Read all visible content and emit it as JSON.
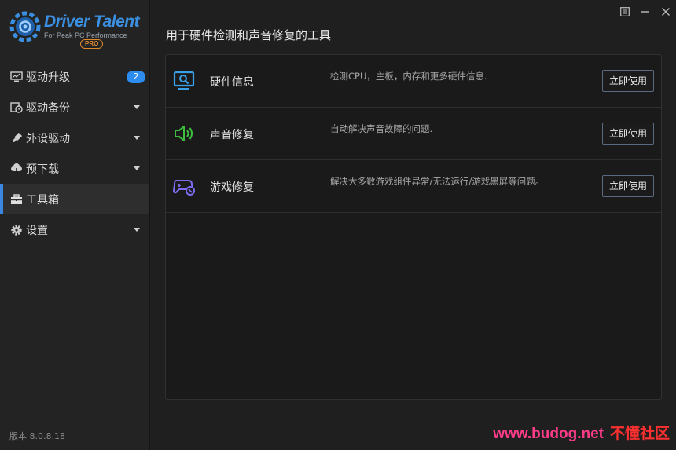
{
  "app": {
    "logo_text": "Driver Talent",
    "logo_sub": "For Peak PC Performance",
    "logo_pro": "PRO",
    "version": "版本 8.0.8.18"
  },
  "sidebar": {
    "items": [
      {
        "label": "驱动升级",
        "icon": "monitor-icon",
        "badge": "2"
      },
      {
        "label": "驱动备份",
        "icon": "clock-backup-icon"
      },
      {
        "label": "外设驱动",
        "icon": "usb-plug-icon"
      },
      {
        "label": "预下载",
        "icon": "cloud-download-icon"
      },
      {
        "label": "工具箱",
        "icon": "toolbox-icon",
        "active": true
      },
      {
        "label": "设置",
        "icon": "gear-icon"
      }
    ]
  },
  "titlebar": {
    "icons": [
      "menu-icon",
      "minimize-icon",
      "close-icon"
    ]
  },
  "main": {
    "title": "用于硬件检测和声音修复的工具",
    "tools": [
      {
        "name": "硬件信息",
        "desc": "检测CPU，主板，内存和更多硬件信息.",
        "button": "立即使用",
        "icon": "hardware-monitor-icon",
        "color": "#3aa0e8"
      },
      {
        "name": "声音修复",
        "desc": "自动解决声音故障的问题.",
        "button": "立即使用",
        "icon": "speaker-icon",
        "color": "#3fbf3f"
      },
      {
        "name": "游戏修复",
        "desc": "解决大多数游戏组件异常/无法运行/游戏黑屏等问题。",
        "button": "立即使用",
        "icon": "gamepad-icon",
        "color": "#7b6cf0"
      }
    ]
  },
  "watermark": {
    "site": "www.budog.net",
    "name": "不懂社区"
  },
  "colors": {
    "accent": "#3a86e0",
    "badge": "#2d8cf0"
  }
}
